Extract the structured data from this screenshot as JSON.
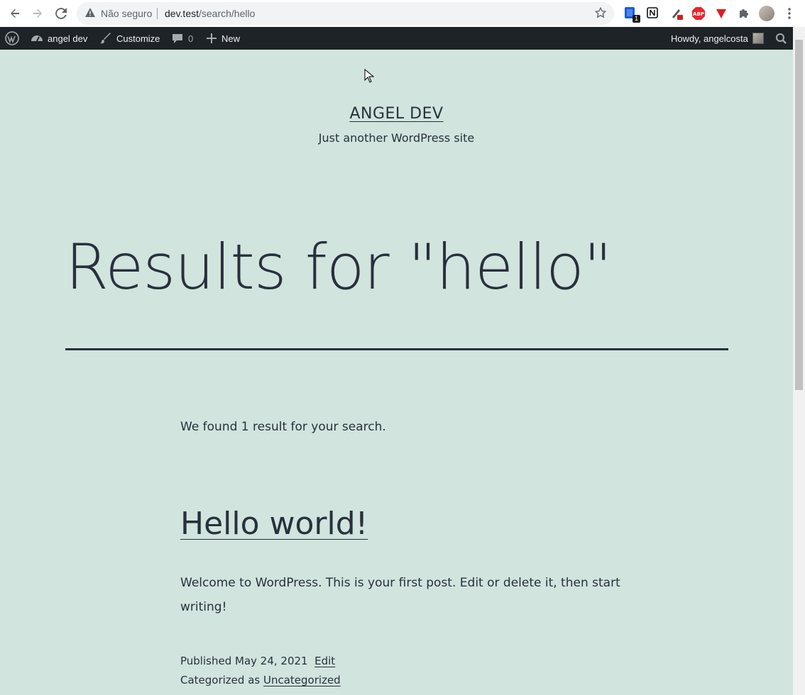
{
  "browser": {
    "security_label": "Não seguro",
    "url_host": "dev.test",
    "url_path": "/search/hello",
    "extensions": [
      {
        "name": "bitwarden-extension",
        "badge": "1"
      },
      {
        "name": "notion-extension"
      },
      {
        "name": "devtools-extension"
      },
      {
        "name": "adblock-extension",
        "label": "ABP"
      },
      {
        "name": "vivaldi-extension"
      },
      {
        "name": "extensions-puzzle"
      }
    ]
  },
  "adminbar": {
    "site_name": "angel dev",
    "customize": "Customize",
    "comments_count": "0",
    "new_label": "New",
    "howdy": "Howdy, angelcosta"
  },
  "site": {
    "title": "ANGEL DEV",
    "description": "Just another WordPress site"
  },
  "search": {
    "heading": "Results for \"hello\"",
    "count_text": "We found 1 result for your search."
  },
  "post": {
    "title": "Hello world!",
    "excerpt": "Welcome to WordPress. This is your first post. Edit or delete it, then start writing!",
    "published_label": "Published",
    "date": "May 24, 2021",
    "edit_label": "Edit",
    "categorized_label": "Categorized as",
    "category": "Uncategorized"
  },
  "colors": {
    "page_bg": "#d1e4dd",
    "text": "#28303d",
    "adminbar_bg": "#1d2327"
  }
}
